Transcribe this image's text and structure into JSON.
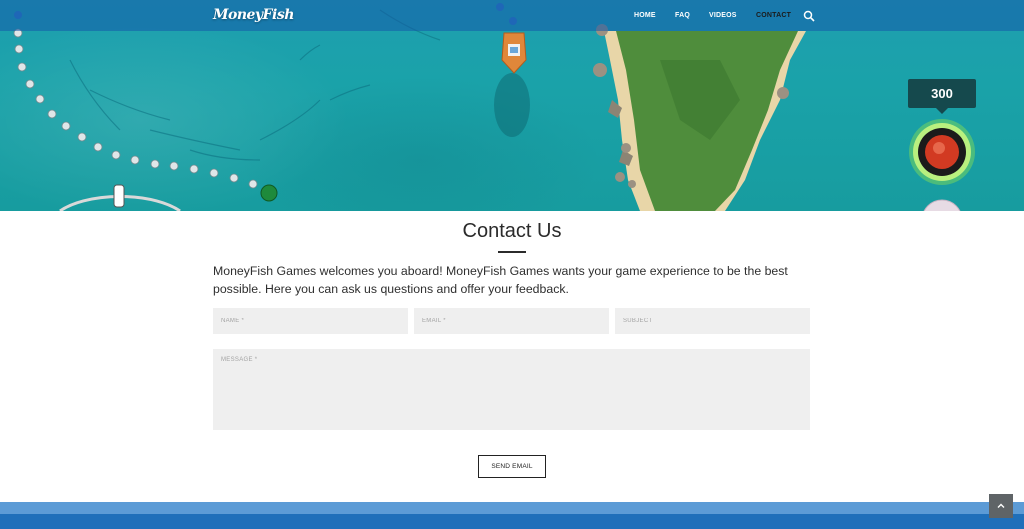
{
  "navbar": {
    "logo_text": "MoneyFish",
    "items": [
      {
        "label": "HOME",
        "active": false
      },
      {
        "label": "FAQ",
        "active": false
      },
      {
        "label": "VIDEOS",
        "active": false
      },
      {
        "label": "CONTACT",
        "active": true
      }
    ],
    "search_icon": "search-icon"
  },
  "hero": {
    "score": "300"
  },
  "contact": {
    "title": "Contact Us",
    "intro": "MoneyFish Games welcomes you aboard! MoneyFish Games wants your game experience to be the best possible. Here you can ask us questions and offer your feedback.",
    "fields": {
      "name_placeholder": "NAME *",
      "email_placeholder": "EMAIL *",
      "subject_placeholder": "SUBJECT",
      "message_placeholder": "MESSAGE *"
    },
    "send_label": "SEND EMAIL"
  },
  "footer": {
    "back_to_top_icon": "chevron-up-icon"
  },
  "colors": {
    "navbar_bg": "#2d6fb0",
    "footer_light": "#5c9bd6",
    "footer_dark": "#1f6fba",
    "score_bg": "#15494d"
  }
}
